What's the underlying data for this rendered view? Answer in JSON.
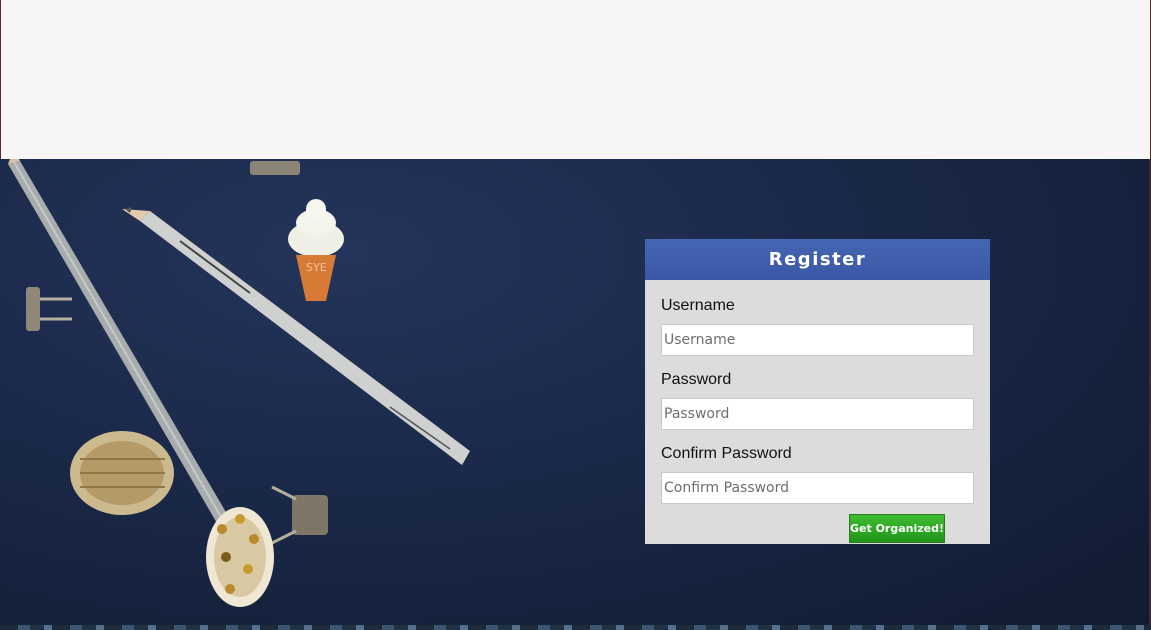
{
  "register": {
    "title": "Register",
    "username_label": "Username",
    "username_placeholder": "Username",
    "password_label": "Password",
    "password_placeholder": "Password",
    "confirm_label": "Confirm Password",
    "confirm_placeholder": "Confirm Password",
    "submit_label": "Get Organized!"
  },
  "colors": {
    "header_blue": "#3f5fae",
    "button_green": "#2ca523",
    "card_gray": "#dcdcdc",
    "background_navy": "#1b2a4b"
  },
  "icons": [
    "pencil-icon",
    "ice-cream-icon",
    "binder-clip-icon",
    "washi-tape-icon"
  ]
}
